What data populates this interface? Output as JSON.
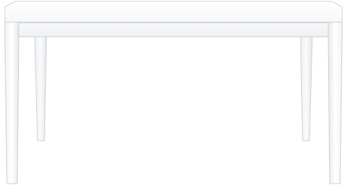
{
  "image": {
    "subject": "white-rectangular-dining-table-icon",
    "background_color": "#ffffff",
    "colors": {
      "table_fill": "#ffffff",
      "table_shadow": "#e9eaec",
      "table_edge": "#cfd2d6",
      "table_edge_dark": "#b9bdc3"
    }
  }
}
